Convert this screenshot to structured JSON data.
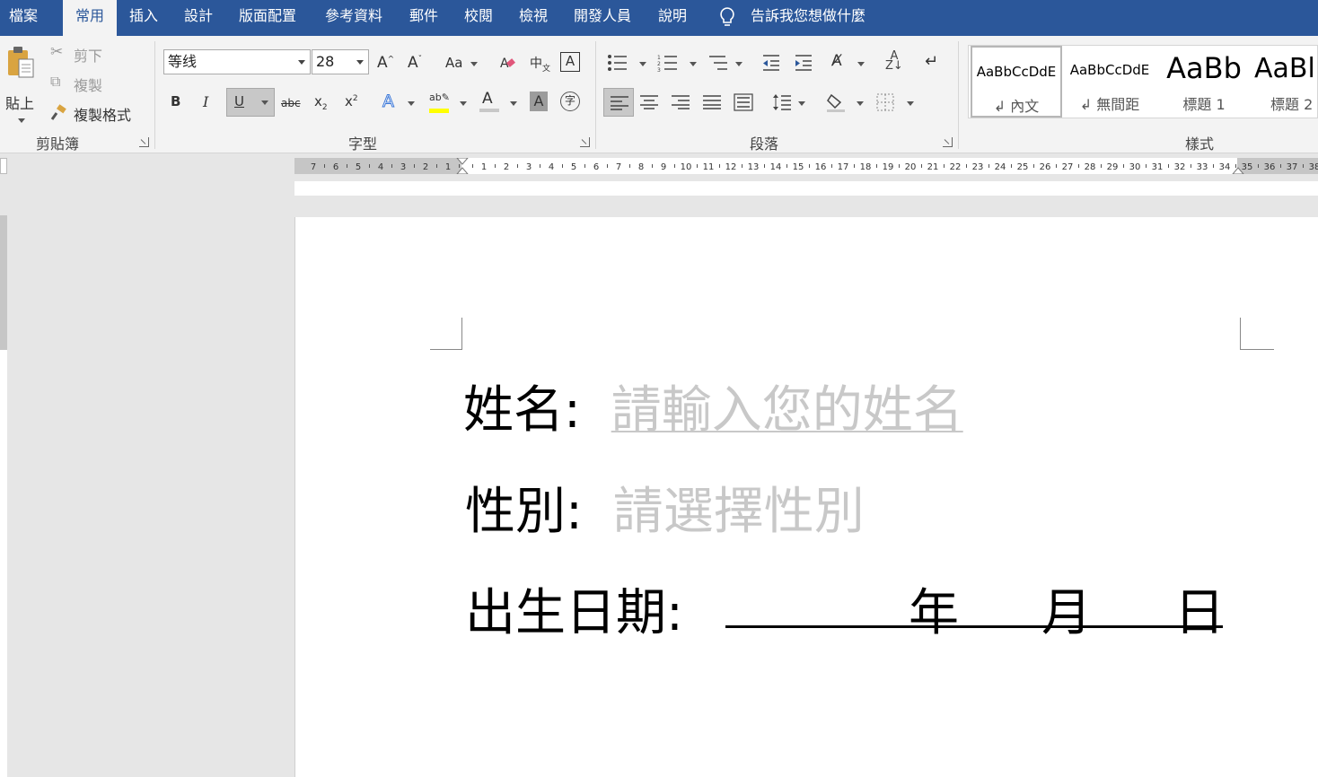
{
  "tabs": [
    {
      "label": "檔案",
      "active": false
    },
    {
      "label": "常用",
      "active": true
    },
    {
      "label": "插入",
      "active": false
    },
    {
      "label": "設計",
      "active": false
    },
    {
      "label": "版面配置",
      "active": false
    },
    {
      "label": "參考資料",
      "active": false
    },
    {
      "label": "郵件",
      "active": false
    },
    {
      "label": "校閱",
      "active": false
    },
    {
      "label": "檢視",
      "active": false
    },
    {
      "label": "開發人員",
      "active": false
    },
    {
      "label": "說明",
      "active": false
    }
  ],
  "tell_me": "告訴我您想做什麼",
  "clipboard": {
    "paste": "貼上",
    "cut": "剪下",
    "copy": "複製",
    "format_painter": "複製格式",
    "group_label": "剪貼簿"
  },
  "font": {
    "name": "等线",
    "size": "28",
    "group_label": "字型"
  },
  "paragraph": {
    "group_label": "段落"
  },
  "styles": {
    "group_label": "樣式",
    "items": [
      {
        "preview": "AaBbCcDdE",
        "name": "↲ 內文",
        "selected": true
      },
      {
        "preview": "AaBbCcDdE",
        "name": "↲ 無間距",
        "selected": false
      },
      {
        "preview": "AaBb",
        "name": "標題 1",
        "selected": false
      },
      {
        "preview": "AaBl",
        "name": "標題 2",
        "selected": false
      }
    ]
  },
  "ruler": {
    "left_numbers": [
      "7",
      "6",
      "5",
      "4",
      "3",
      "2",
      "1"
    ],
    "right_numbers": [
      "1",
      "2",
      "3",
      "4",
      "5",
      "6",
      "7",
      "8",
      "9",
      "10",
      "11",
      "12",
      "13",
      "14",
      "15",
      "16",
      "17",
      "18",
      "19",
      "20",
      "21",
      "22",
      "23",
      "24",
      "25",
      "26",
      "27",
      "28",
      "29",
      "30",
      "31",
      "32",
      "33",
      "34",
      "35",
      "36",
      "37",
      "38"
    ]
  },
  "document": {
    "name_label": "姓名:",
    "name_placeholder": "請輸入您的姓名",
    "gender_label": "性別:",
    "gender_placeholder": "請選擇性別",
    "dob_label": "出生日期:",
    "year": "年",
    "month": "月",
    "day": "日"
  },
  "colors": {
    "tab_bar": "#2b579a",
    "ribbon_bg": "#f3f3f3",
    "highlight": "#ffff00",
    "placeholder_text": "#c8c8c8"
  }
}
